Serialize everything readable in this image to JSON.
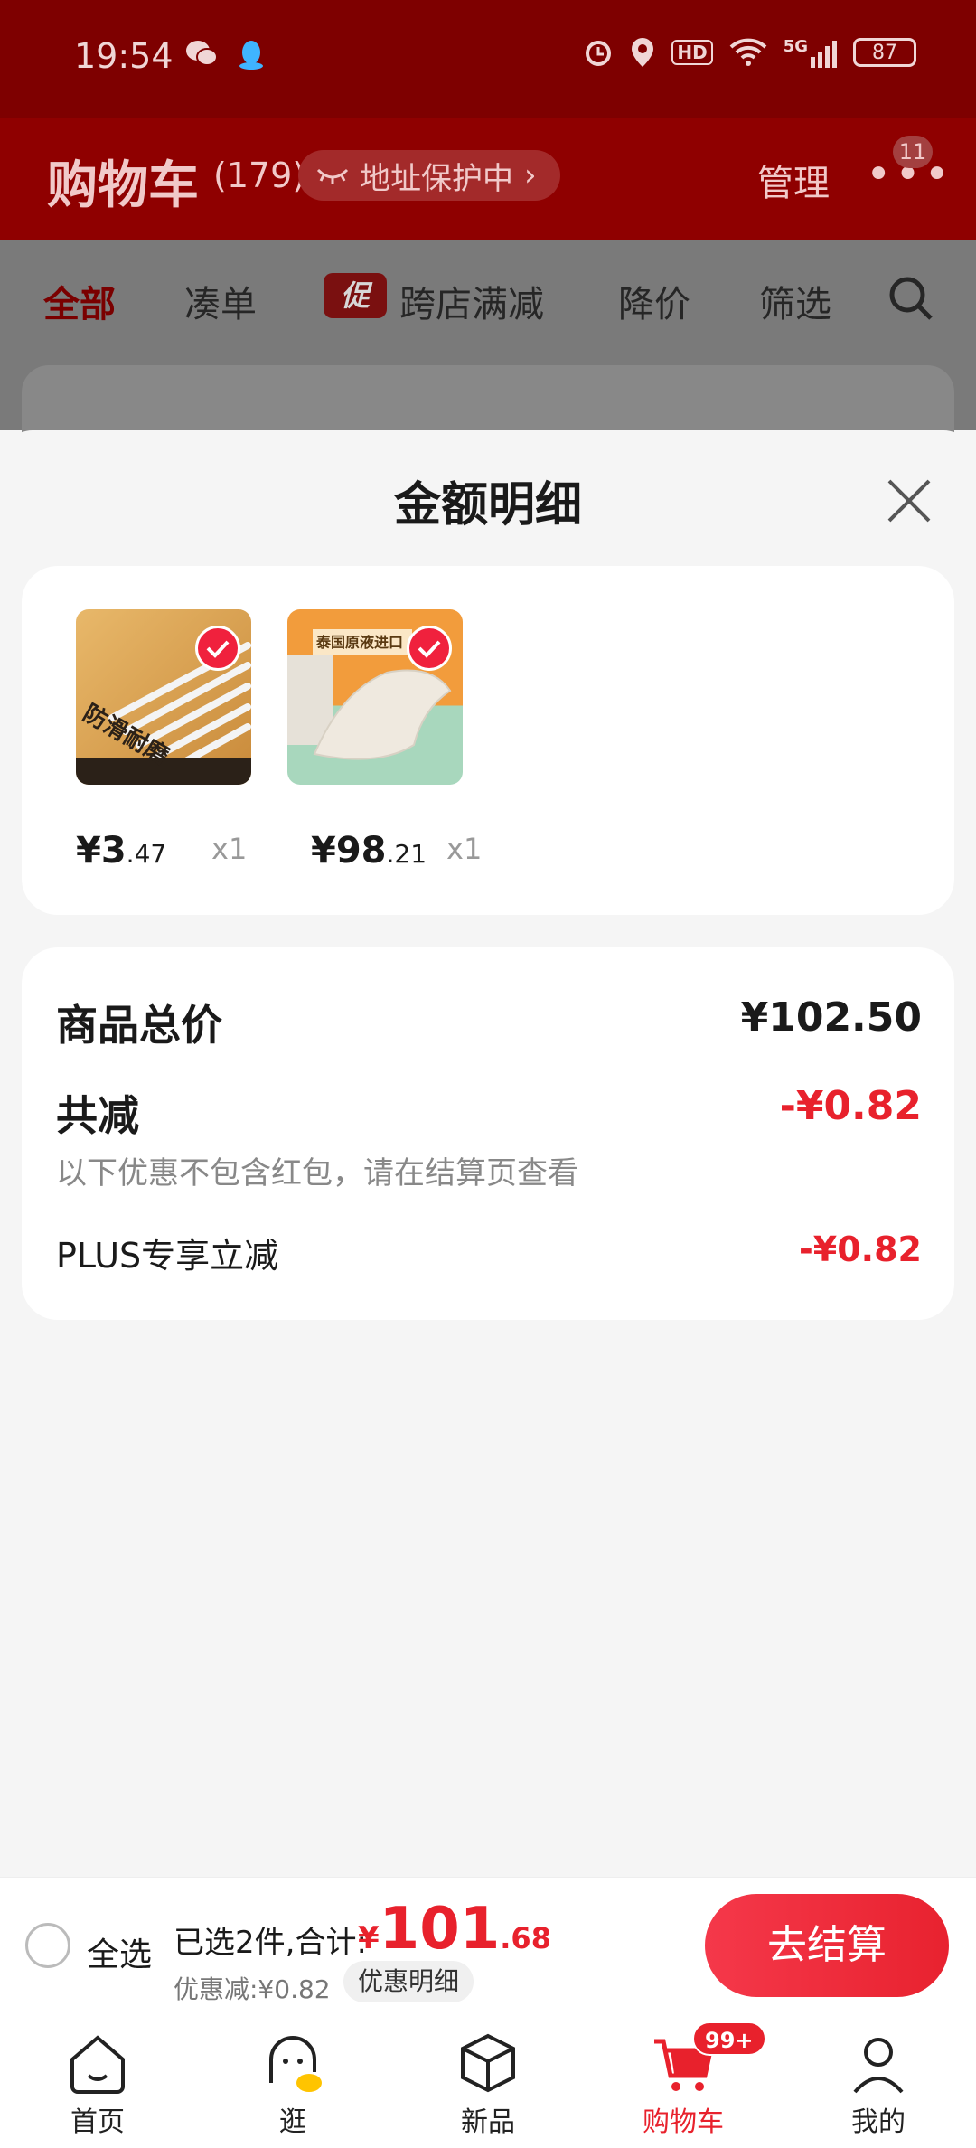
{
  "status_bar": {
    "time": "19:54",
    "left_icons": [
      "wechat-icon",
      "qq-icon"
    ],
    "right_icons": [
      "alarm-icon",
      "location-icon",
      "hd-icon",
      "wifi-icon",
      "5g-signal-icon"
    ],
    "hd": "HD",
    "network": "5G",
    "battery": "87"
  },
  "header": {
    "title": "购物车",
    "count": "(179)",
    "address_protect": "地址保护中",
    "manage": "管理",
    "more_badge": "11"
  },
  "tabs": [
    {
      "label": "全部",
      "active": true
    },
    {
      "label": "凑单"
    },
    {
      "label": "跨店满减",
      "tag": "促"
    },
    {
      "label": "降价"
    },
    {
      "label": "筛选"
    }
  ],
  "sheet": {
    "title": "金额明细",
    "products": [
      {
        "price_int": "¥3",
        "price_dec": ".47",
        "qty": "x1",
        "image_text": "防滑耐磨"
      },
      {
        "price_int": "¥98",
        "price_dec": ".21",
        "qty": "x1",
        "image_text": "泰国原液进口"
      }
    ],
    "summary": {
      "total_label": "商品总价",
      "total_value": "¥102.50",
      "discount_label": "共减",
      "discount_value": "-¥0.82",
      "discount_note": "以下优惠不包含红包，请在结算页查看",
      "plus_label": "PLUS专享立减",
      "plus_value": "-¥0.82"
    }
  },
  "checkout": {
    "select_all": "全选",
    "selected_text": "已选2件,合计:",
    "total_yen": "¥",
    "total_int": "101",
    "total_dec": ".68",
    "discount_text": "优惠减:¥0.82",
    "detail_button": "优惠明细",
    "checkout_button": "去结算"
  },
  "tabbar": [
    {
      "label": "首页",
      "icon": "home-icon"
    },
    {
      "label": "逛",
      "icon": "browse-icon"
    },
    {
      "label": "新品",
      "icon": "new-box-icon"
    },
    {
      "label": "购物车",
      "icon": "cart-icon",
      "active": true,
      "badge": "99+"
    },
    {
      "label": "我的",
      "icon": "profile-icon"
    }
  ],
  "colors": {
    "brand_red": "#e8212c",
    "header_dim": "#8f0000"
  }
}
